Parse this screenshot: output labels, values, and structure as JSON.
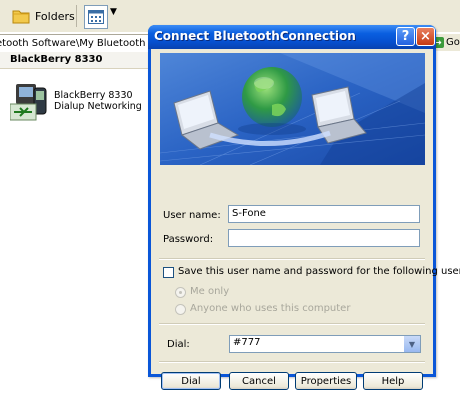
{
  "explorer": {
    "toolbar": {
      "folders_label": "Folders"
    },
    "address": "etooth Software\\My Bluetooth Places",
    "go_label": "Go",
    "folder_heading": "BlackBerry 8330",
    "device": {
      "label": "BlackBerry 8330 Dialup Networking"
    }
  },
  "dialog": {
    "title": "Connect BluetoothConnection",
    "help_glyph": "?",
    "close_glyph": "×",
    "fields": {
      "username_label": "User name:",
      "username_value": "S-Fone",
      "password_label": "Password:",
      "password_value": ""
    },
    "save_checkbox": {
      "label": "Save this user name and password for the following users:",
      "checked": false
    },
    "radios": [
      {
        "label": "Me only",
        "selected": true
      },
      {
        "label": "Anyone who uses this computer",
        "selected": false
      }
    ],
    "dial": {
      "label": "Dial:",
      "value": "#777"
    },
    "buttons": {
      "dial": "Dial",
      "cancel": "Cancel",
      "properties": "Properties",
      "help": "Help"
    }
  },
  "colors": {
    "titlebar": "#0a56d8",
    "face": "#ece9d8",
    "field_border": "#7f9db9"
  }
}
